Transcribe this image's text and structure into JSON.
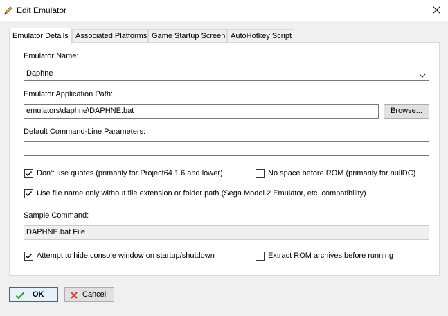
{
  "window": {
    "title": "Edit Emulator",
    "title_icon": "pencil-icon",
    "close_icon": "close-icon"
  },
  "tabs": [
    {
      "label": "Emulator Details",
      "active": true
    },
    {
      "label": "Associated Platforms",
      "active": false
    },
    {
      "label": "Game Startup Screen",
      "active": false
    },
    {
      "label": "AutoHotkey Script",
      "active": false
    }
  ],
  "form": {
    "name_label": "Emulator Name:",
    "name_value": "Daphne",
    "path_label": "Emulator Application Path:",
    "path_value": "emulators\\daphne\\DAPHNE.bat",
    "browse_label": "Browse...",
    "params_label": "Default Command-Line Parameters:",
    "params_value": "",
    "sample_label": "Sample Command:",
    "sample_value": "DAPHNE.bat File"
  },
  "checkboxes": {
    "no_quotes": {
      "label": "Don't use quotes (primarily for Project64 1.6 and lower)",
      "checked": true
    },
    "no_space": {
      "label": "No space before ROM (primarily for nullDC)",
      "checked": false
    },
    "file_name_only": {
      "label": "Use file name only without file extension or folder path (Sega Model 2 Emulator, etc. compatibility)",
      "checked": true
    },
    "hide_console": {
      "label": "Attempt to hide console window on startup/shutdown",
      "checked": true
    },
    "extract_rom": {
      "label": "Extract ROM archives before running",
      "checked": false
    }
  },
  "buttons": {
    "ok_label": "OK",
    "ok_icon": "checkmark-icon",
    "cancel_label": "Cancel",
    "cancel_icon": "x-icon"
  },
  "colors": {
    "ok_check": "#3a9d23",
    "cancel_x": "#d9342b",
    "focus_border": "#0078d7"
  }
}
